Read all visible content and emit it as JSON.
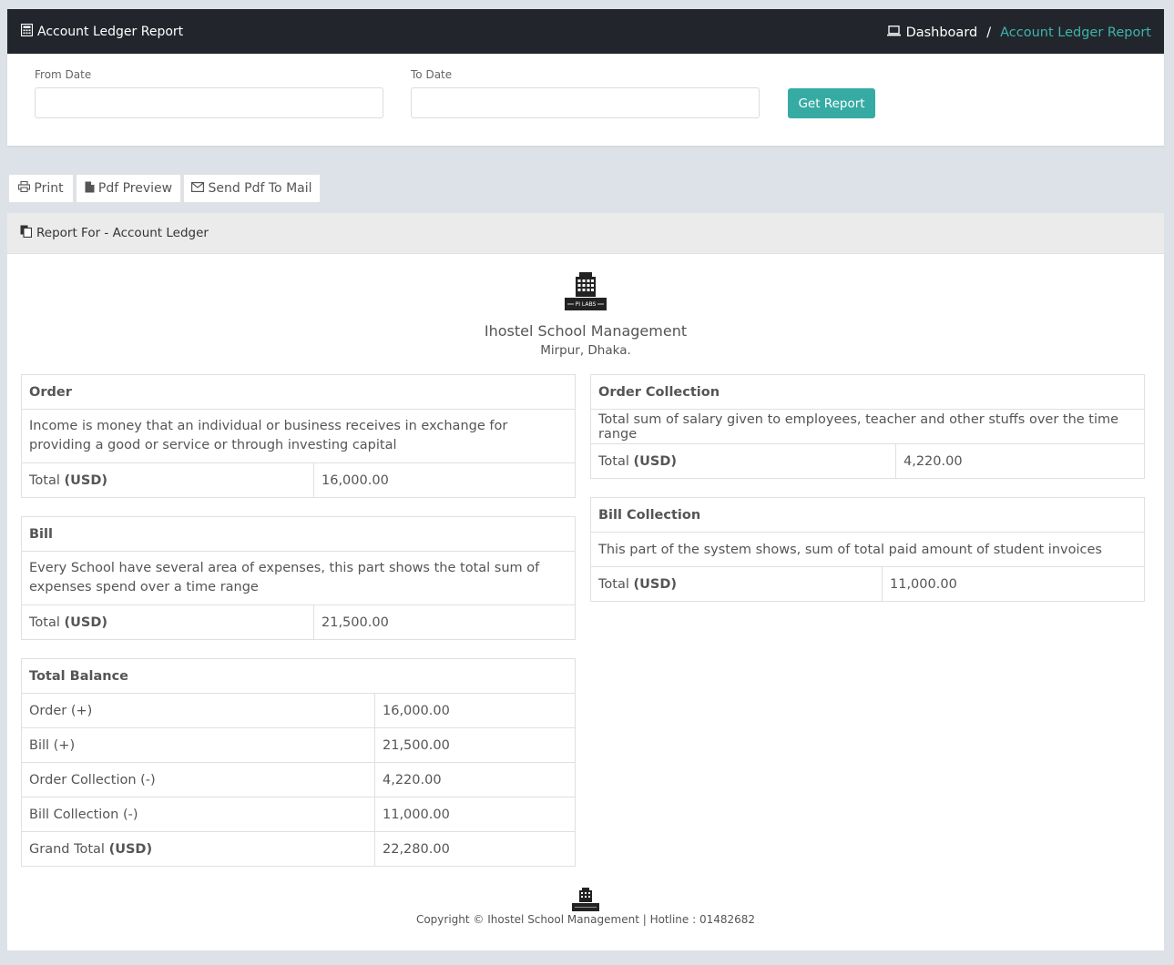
{
  "header": {
    "title": "Account Ledger Report",
    "breadcrumb_home": "Dashboard",
    "breadcrumb_sep": "/",
    "breadcrumb_active": "Account Ledger Report"
  },
  "filter": {
    "from_label": "From Date",
    "from_value": "",
    "to_label": "To Date",
    "to_value": "",
    "button": "Get Report"
  },
  "actions": {
    "print": "Print",
    "pdf_preview": "Pdf Preview",
    "send_mail": "Send Pdf To Mail"
  },
  "report": {
    "heading": "Report For - Account Ledger",
    "school_name": "Ihostel School Management",
    "address": "Mirpur, Dhaka.",
    "logo_text": "PI LABS"
  },
  "order": {
    "title": "Order",
    "description": "Income is money that an individual or business receives in exchange for providing a good or service or through investing capital",
    "total_label": "Total",
    "currency": "(USD)",
    "total_value": "16,000.00"
  },
  "bill": {
    "title": "Bill",
    "description": "Every School have several area of expenses, this part shows the total sum of expenses spend over a time range",
    "total_label": "Total",
    "currency": "(USD)",
    "total_value": "21,500.00"
  },
  "order_collection": {
    "title": "Order Collection",
    "description": "Total sum of salary given to employees, teacher and other stuffs over the time range",
    "total_label": "Total",
    "currency": "(USD)",
    "total_value": "4,220.00"
  },
  "bill_collection": {
    "title": "Bill Collection",
    "description": "This part of the system shows, sum of total paid amount of student invoices",
    "total_label": "Total",
    "currency": "(USD)",
    "total_value": "11,000.00"
  },
  "balance": {
    "title": "Total Balance",
    "rows": [
      {
        "label": "Order (+)",
        "value": "16,000.00"
      },
      {
        "label": "Bill (+)",
        "value": "21,500.00"
      },
      {
        "label": "Order Collection (-)",
        "value": "4,220.00"
      },
      {
        "label": "Bill Collection (-)",
        "value": "11,000.00"
      }
    ],
    "grand_label": "Grand Total",
    "currency": "(USD)",
    "grand_value": "22,280.00"
  },
  "footer": {
    "copyright": "Copyright © Ihostel School Management | Hotline : 01482682"
  },
  "colors": {
    "topbar": "#22262c",
    "accent": "#35aba4",
    "page_bg": "#dde2e9"
  }
}
